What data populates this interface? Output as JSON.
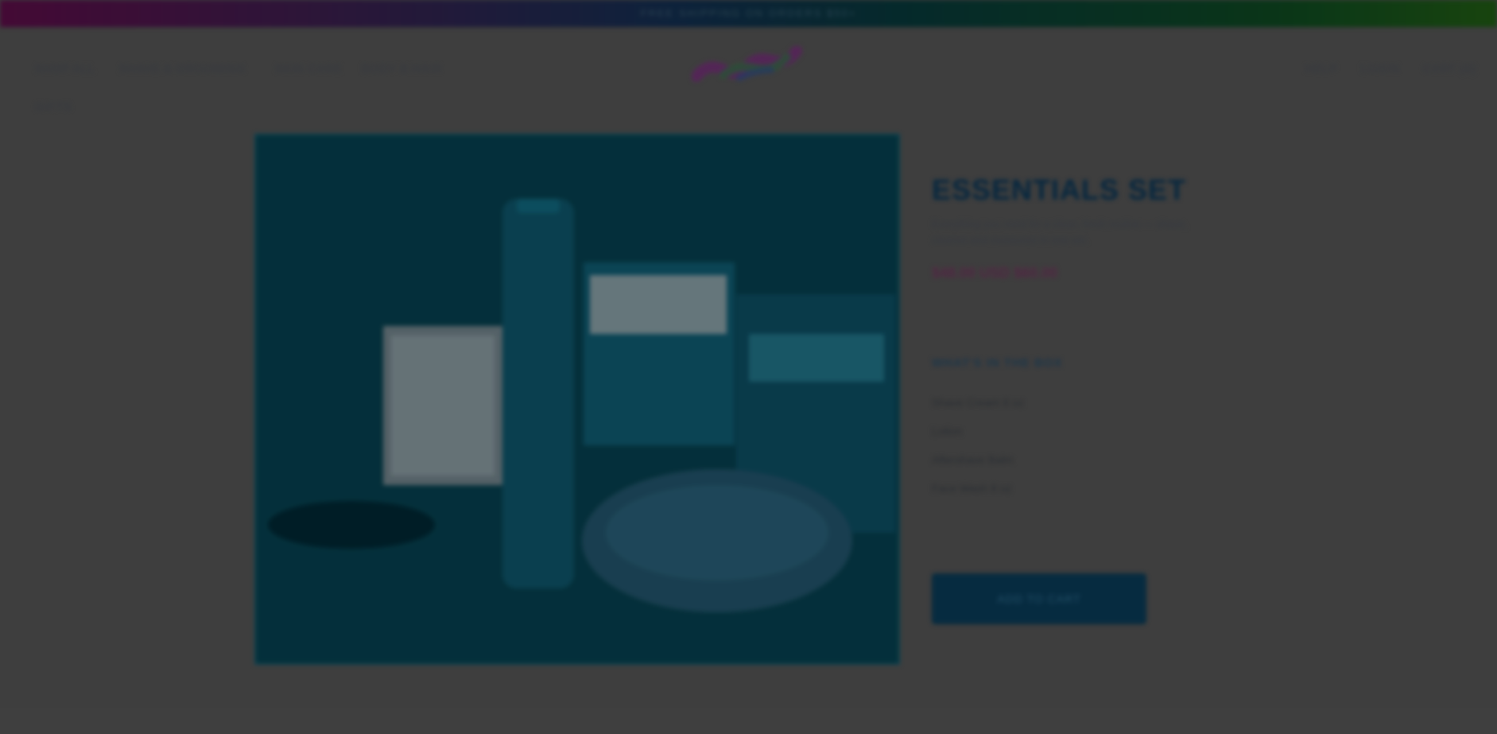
{
  "topbar": {
    "text": "FREE SHIPPING ON ORDERS $50+"
  },
  "nav": {
    "left": [
      "SHOP ALL",
      "SHAVE & GROOMING",
      "SKIN CARE",
      "BODY & HAIR",
      "GIFTS"
    ],
    "right": [
      "HELP",
      "LOGIN",
      "CART (0)"
    ]
  },
  "product": {
    "title": "ESSENTIALS SET",
    "description": "Everything you need for a clean, fresh routine — shave, cleanse and moisturize in one set.",
    "price": "$48.00 USD  $60.00",
    "includes_title": "WHAT'S IN THE BOX",
    "includes": [
      "Shave Cream 6 oz",
      "Lotion",
      "Aftershave Balm",
      "Face Wash 8 oz"
    ],
    "cta_label": "ADD TO CART"
  },
  "colors": {
    "page_bg": "#444444",
    "hero_bg": "#053440",
    "title": "#062a45",
    "cta_bg": "#072f46"
  }
}
